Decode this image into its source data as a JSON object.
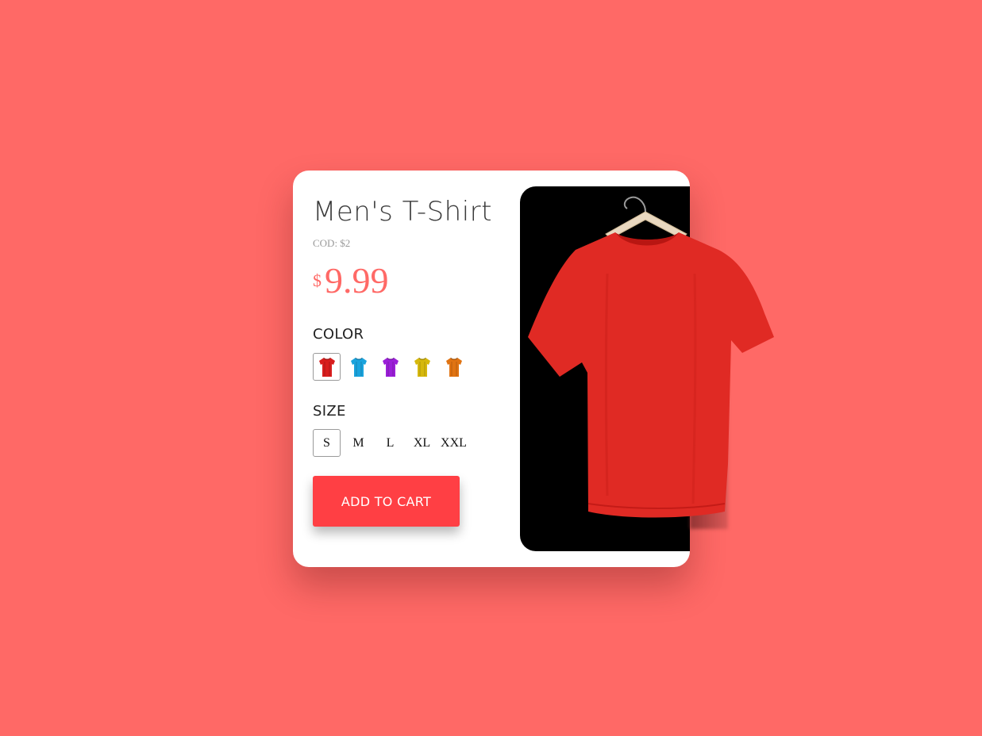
{
  "product": {
    "title": "Men's T-Shirt",
    "cod": "COD: $2",
    "price_currency": "$",
    "price_amount": "9.99"
  },
  "color": {
    "label": "COLOR",
    "options": [
      {
        "name": "red",
        "hex": "#d81e1e",
        "selected": true
      },
      {
        "name": "blue",
        "hex": "#1aa3dd",
        "selected": false
      },
      {
        "name": "purple",
        "hex": "#9b1fd8",
        "selected": false
      },
      {
        "name": "yellow",
        "hex": "#d6b80d",
        "selected": false
      },
      {
        "name": "orange",
        "hex": "#e07312",
        "selected": false
      }
    ]
  },
  "size": {
    "label": "SIZE",
    "options": [
      "S",
      "M",
      "L",
      "XL",
      "XXL"
    ],
    "selected": "S"
  },
  "cart": {
    "button_label": "ADD TO CART"
  },
  "colors": {
    "background": "#ff6966",
    "price": "#ff6966",
    "button": "#ff3f44",
    "shirt": "#e02a24"
  },
  "icons": {
    "swatch": "tshirt-icon",
    "product": "tshirt-on-hanger"
  }
}
